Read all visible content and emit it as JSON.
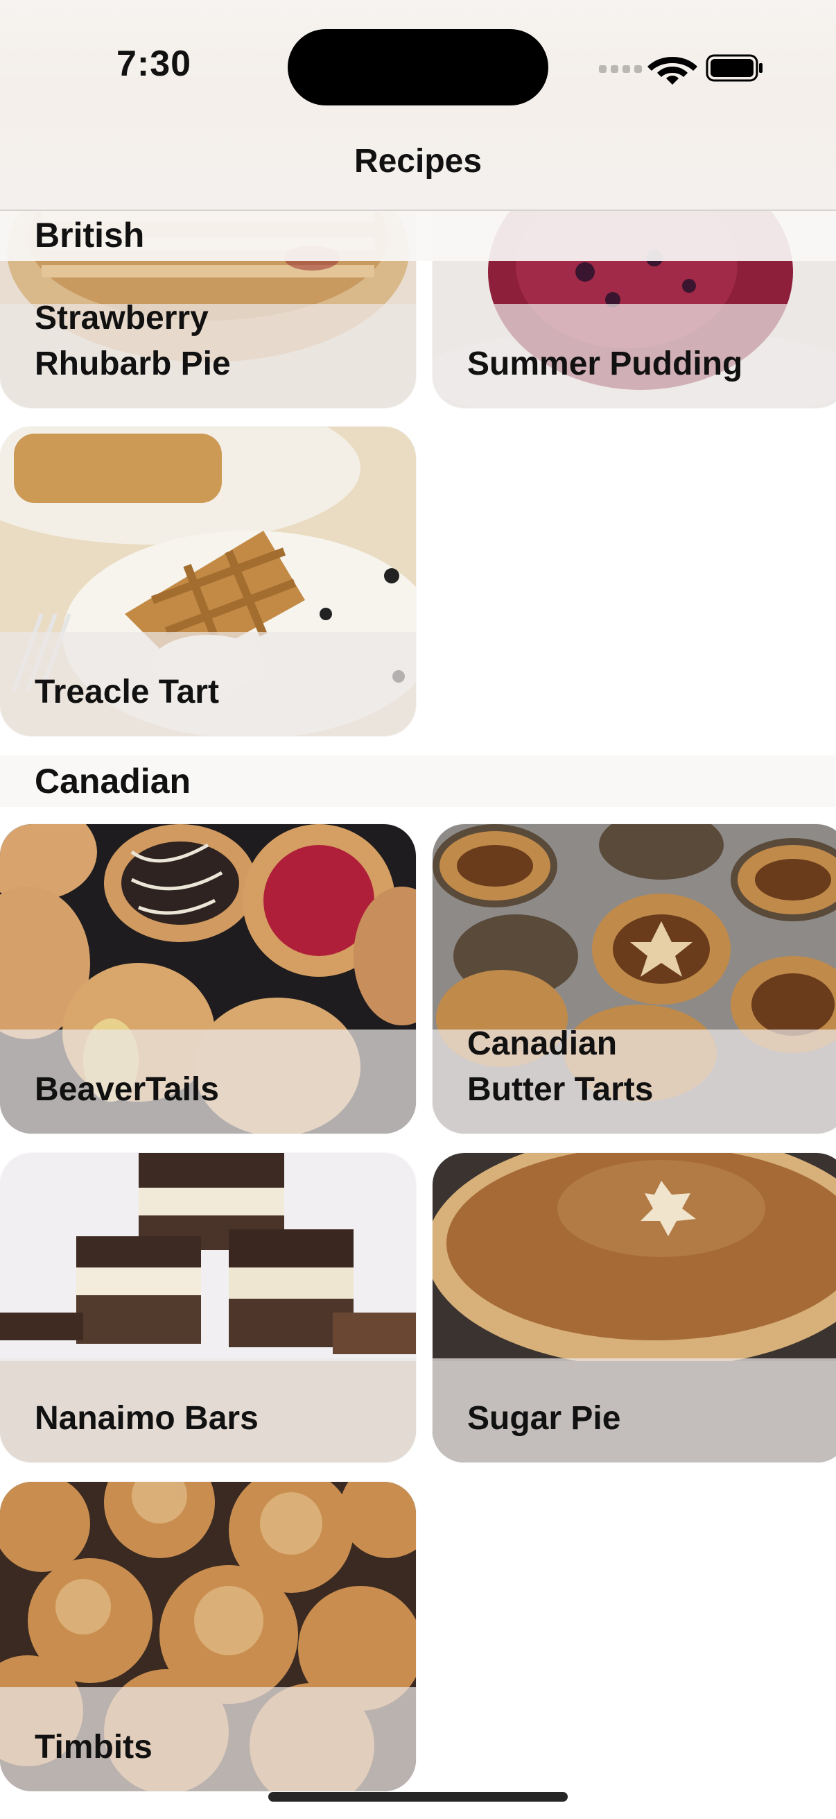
{
  "status_bar": {
    "time": "7:30",
    "icons": [
      "cellular-signal-icon",
      "wifi-icon",
      "battery-icon"
    ]
  },
  "nav": {
    "title": "Recipes"
  },
  "sections": [
    {
      "title": "British",
      "recipes": [
        {
          "name": "Strawberry Rhubarb Pie",
          "line1": "Strawberry",
          "line2": "Rhubarb Pie"
        },
        {
          "name": "Summer Pudding",
          "line1": "Summer Pudding",
          "line2": ""
        },
        {
          "name": "Treacle Tart",
          "line1": "Treacle Tart",
          "line2": ""
        }
      ]
    },
    {
      "title": "Canadian",
      "recipes": [
        {
          "name": "BeaverTails",
          "line1": "BeaverTails",
          "line2": ""
        },
        {
          "name": "Canadian Butter Tarts",
          "line1": "Canadian",
          "line2": "Butter Tarts"
        },
        {
          "name": "Nanaimo Bars",
          "line1": "Nanaimo Bars",
          "line2": ""
        },
        {
          "name": "Sugar Pie",
          "line1": "Sugar Pie",
          "line2": ""
        },
        {
          "name": "Timbits",
          "line1": "Timbits",
          "line2": ""
        }
      ]
    }
  ],
  "colors": {
    "background": "#ffffff",
    "caption_overlay": "#ebe8e6",
    "text": "#111111"
  }
}
